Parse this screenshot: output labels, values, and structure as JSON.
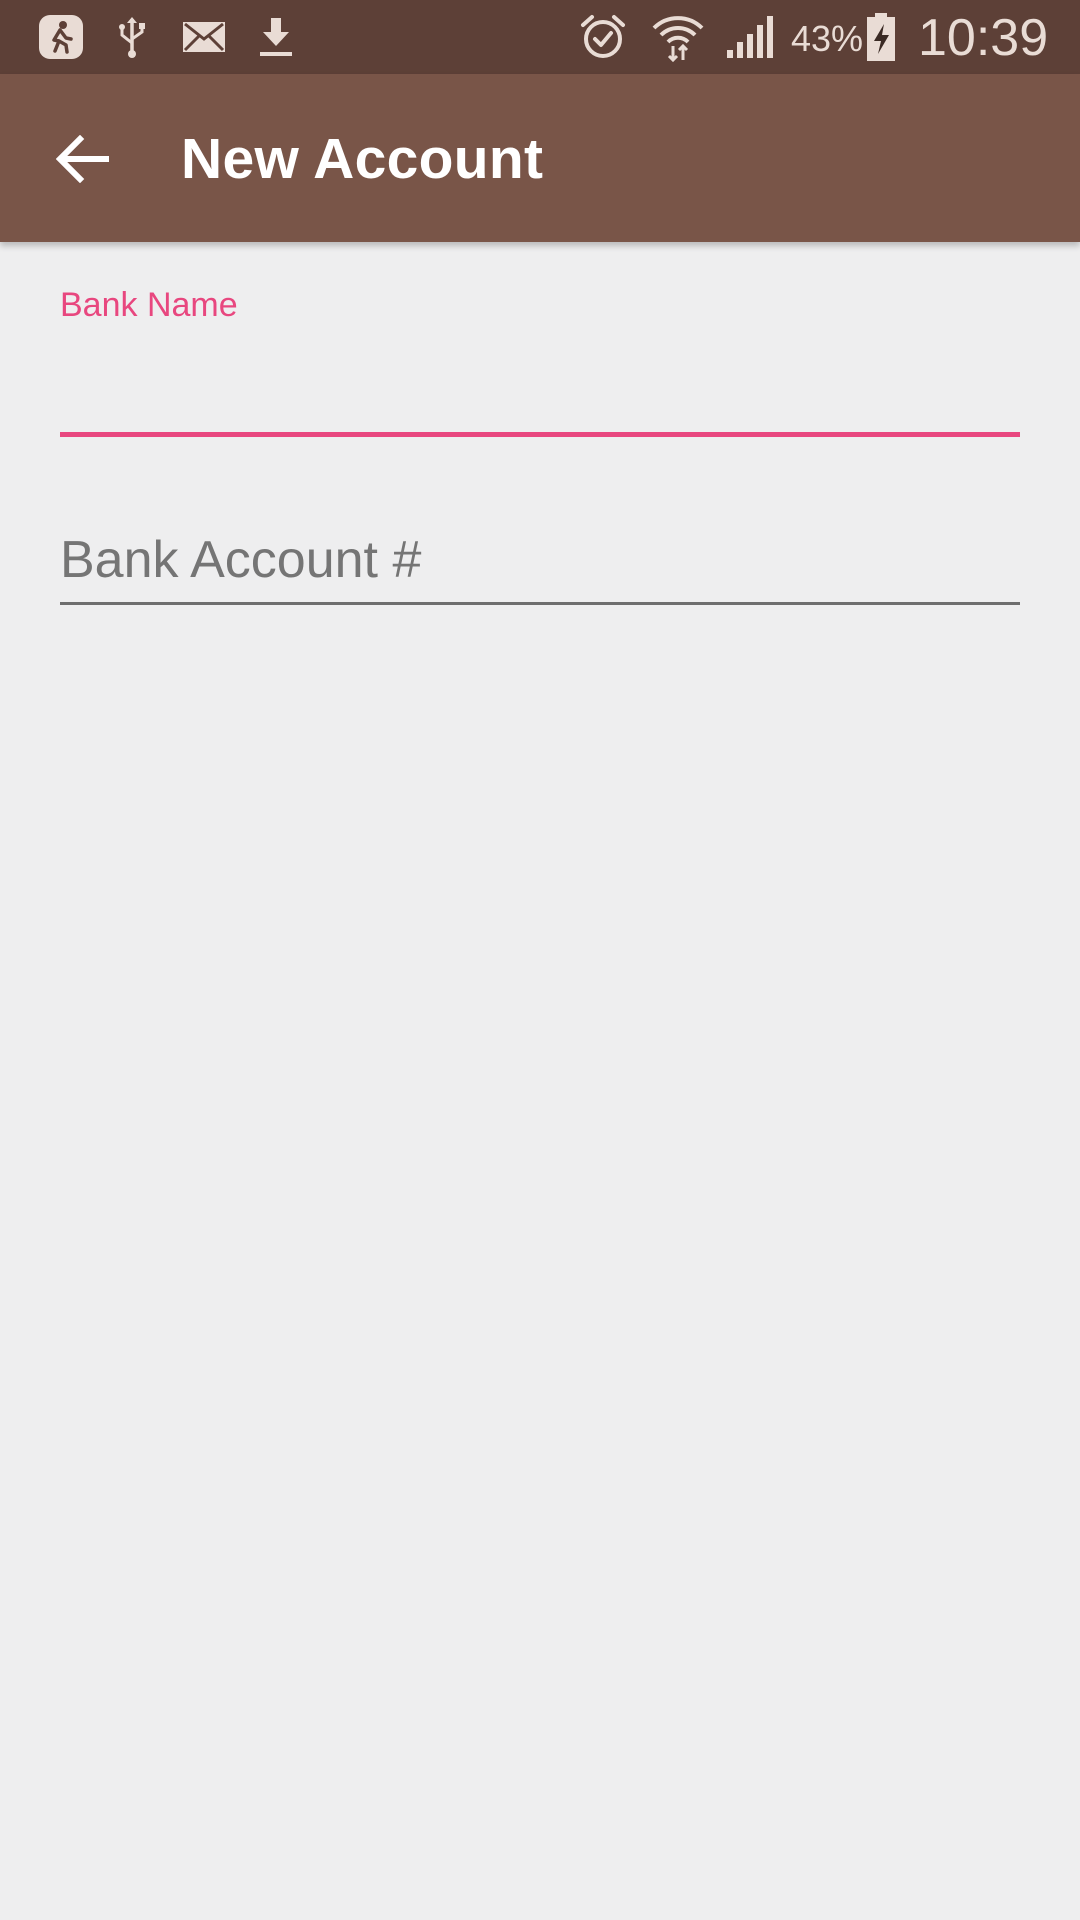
{
  "status_bar": {
    "battery_percent": "43%",
    "time": "10:39",
    "icons": [
      "fitness-app-icon",
      "usb-icon",
      "mail-icon",
      "download-icon",
      "alarm-icon",
      "wifi-icon",
      "cell-signal-icon",
      "battery-charging-icon"
    ]
  },
  "app_bar": {
    "title": "New Account",
    "back_icon": "arrow-back-icon"
  },
  "form": {
    "bank_name": {
      "label": "Bank Name",
      "value": ""
    },
    "bank_account": {
      "placeholder": "Bank Account #",
      "value": ""
    }
  },
  "colors": {
    "status_bar": "#5d4037",
    "app_bar": "#795548",
    "accent": "#e8477f",
    "background": "#eeeeef"
  }
}
